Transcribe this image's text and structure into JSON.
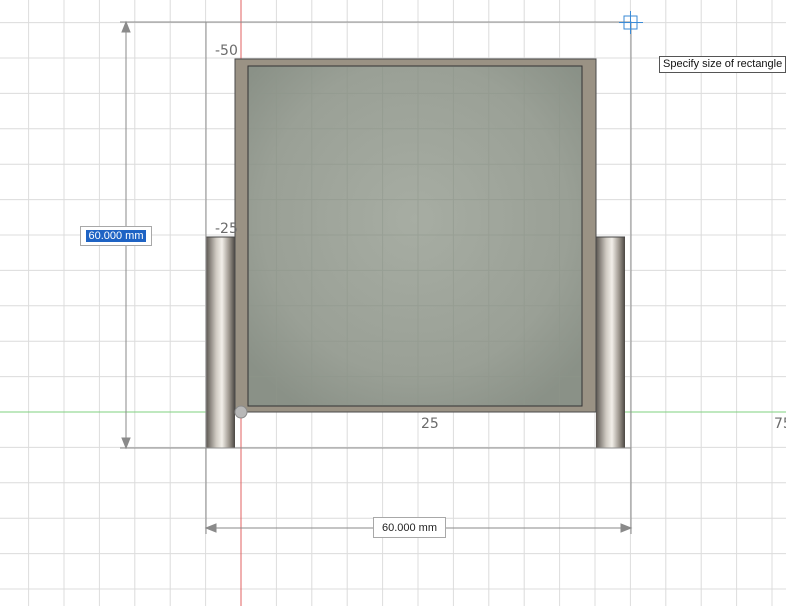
{
  "viewport": {
    "axis_labels": {
      "neg50": "-50",
      "neg25": "-25",
      "pos25": "25",
      "pos75": "75"
    },
    "colors": {
      "grid": "#dcdcdc",
      "y_axis": "#e06060",
      "x_axis": "#7fd07f",
      "plate_frame": "#9a9284",
      "plate_face": "#9ea59a",
      "dimension_line": "#8a8a8a",
      "sketch_outline": "#8f8f8f",
      "cursor": "#3a8ad6"
    }
  },
  "dimensions": {
    "height_value": "60.000 mm",
    "width_value": "60.000 mm"
  },
  "tooltip": {
    "text": "Specify size of rectangle"
  },
  "icons": {
    "cursor": "crosshair-square-icon",
    "origin": "origin-marker-icon"
  }
}
